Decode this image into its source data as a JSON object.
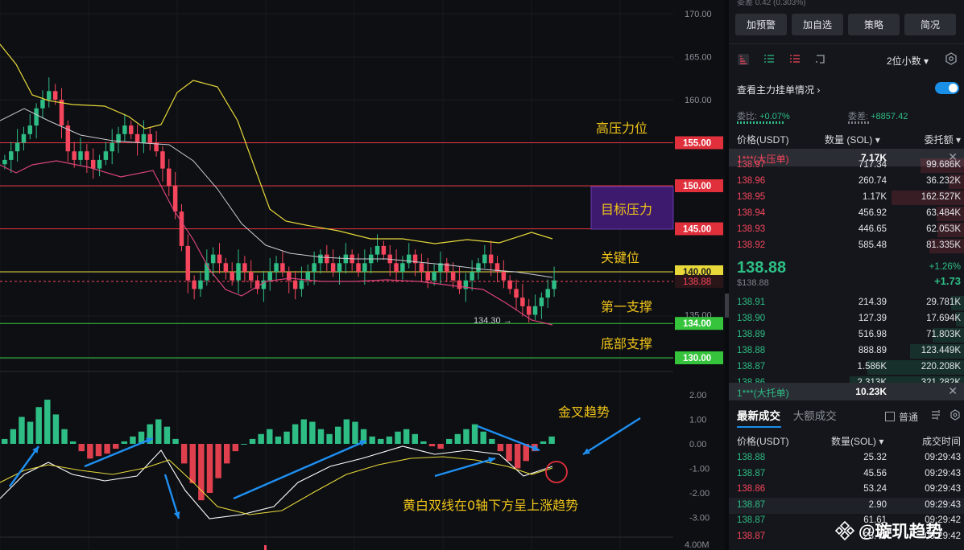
{
  "price_axis": {
    "ticks": [
      "170.00",
      "165.00",
      "160.00",
      "155.00",
      "150.00",
      "145.00",
      "140.00",
      "135.00",
      "130.00"
    ],
    "macd_ticks": [
      "2.00",
      "1.00",
      "0.00",
      "-1.00",
      "-2.00",
      "-3.00"
    ],
    "vol_tick": "4.00M"
  },
  "levels": [
    {
      "price": 155,
      "label": "155.00",
      "color": "#e0303c",
      "text": "高压力位"
    },
    {
      "price": 150,
      "label": "150.00",
      "color": "#e0303c",
      "text": ""
    },
    {
      "price": 145,
      "label": "145.00",
      "color": "#e0303c",
      "text": "目标压力"
    },
    {
      "price": 140,
      "label": "140.00",
      "color": "#e8d83a",
      "text": "关键位"
    },
    {
      "price": 134,
      "label": "134.00",
      "color": "#35c43c",
      "text": "第一支撑"
    },
    {
      "price": 130,
      "label": "130.00",
      "color": "#35c43c",
      "text": "底部支撑"
    }
  ],
  "current_price_tag": "138.88",
  "low_marker": "134.30",
  "annotations": {
    "golden_cross": "金叉趋势",
    "macd_note": "黄白双线在0轴下方呈上涨趋势"
  },
  "panel": {
    "top_info": "委差 0.42 (0.303%)",
    "buttons": [
      "加预警",
      "加自选",
      "策略",
      "简况"
    ],
    "decimals": "2位小数",
    "main_orders_label": "查看主力挂单情况",
    "wei_bi_label": "委比:",
    "wei_bi_value": "+0.07%",
    "wei_cha_label": "委差:",
    "wei_cha_value": "+8857.42",
    "ob_headers": {
      "price": "价格(USDT)",
      "qty": "数量 (SOL)",
      "total": "委托额"
    },
    "big_ask": {
      "label": "1***(大压单)",
      "qty": "7.17K"
    },
    "asks": [
      {
        "price": "138.97",
        "qty": "717.34",
        "total": "99.686K",
        "depth": 0.36
      },
      {
        "price": "138.96",
        "qty": "260.74",
        "total": "36.232K",
        "depth": 0.13
      },
      {
        "price": "138.95",
        "qty": "1.17K",
        "total": "162.527K",
        "depth": 0.6
      },
      {
        "price": "138.94",
        "qty": "456.92",
        "total": "63.484K",
        "depth": 0.23
      },
      {
        "price": "138.93",
        "qty": "446.65",
        "total": "62.053K",
        "depth": 0.22
      },
      {
        "price": "138.92",
        "qty": "585.48",
        "total": "81.335K",
        "depth": 0.29
      }
    ],
    "last_price": "138.88",
    "last_price_usd": "$138.88",
    "change_pct": "+1.26%",
    "change_abs": "+1.73",
    "bids": [
      {
        "price": "138.91",
        "qty": "214.39",
        "total": "29.781K",
        "depth": 0.11
      },
      {
        "price": "138.90",
        "qty": "127.39",
        "total": "17.694K",
        "depth": 0.07
      },
      {
        "price": "138.89",
        "qty": "516.98",
        "total": "71.803K",
        "depth": 0.26
      },
      {
        "price": "138.88",
        "qty": "888.89",
        "total": "123.449K",
        "depth": 0.45
      },
      {
        "price": "138.87",
        "qty": "1.586K",
        "total": "220.208K",
        "depth": 0.8
      },
      {
        "price": "138.86",
        "qty": "2.313K",
        "total": "321.282K",
        "depth": 0.95
      }
    ],
    "big_bid": {
      "label": "1***(大托单)",
      "qty": "10.23K"
    },
    "trade_tabs": [
      "最新成交",
      "大额成交"
    ],
    "normal_label": "普通",
    "trade_headers": {
      "price": "价格(USDT)",
      "qty": "数量(SOL)",
      "time": "成交时间"
    },
    "trades": [
      {
        "price": "138.88",
        "qty": "25.32",
        "time": "09:29:43",
        "side": "buy"
      },
      {
        "price": "138.87",
        "qty": "45.56",
        "time": "09:29:43",
        "side": "buy"
      },
      {
        "price": "138.86",
        "qty": "53.24",
        "time": "09:29:43",
        "side": "sell"
      },
      {
        "price": "138.87",
        "qty": "2.90",
        "time": "09:29:43",
        "side": "buy"
      },
      {
        "price": "138.87",
        "qty": "61.61",
        "time": "09:29:42",
        "side": "buy"
      },
      {
        "price": "138.87",
        "qty": "23.43",
        "time": "09:29:42",
        "side": "sell"
      }
    ],
    "watermark": "@璇玑趋势"
  },
  "colors": {
    "up": "#2ebd85",
    "down": "#f6465d",
    "accent": "#1a8fe8",
    "purple": "#3d1a6e"
  }
}
